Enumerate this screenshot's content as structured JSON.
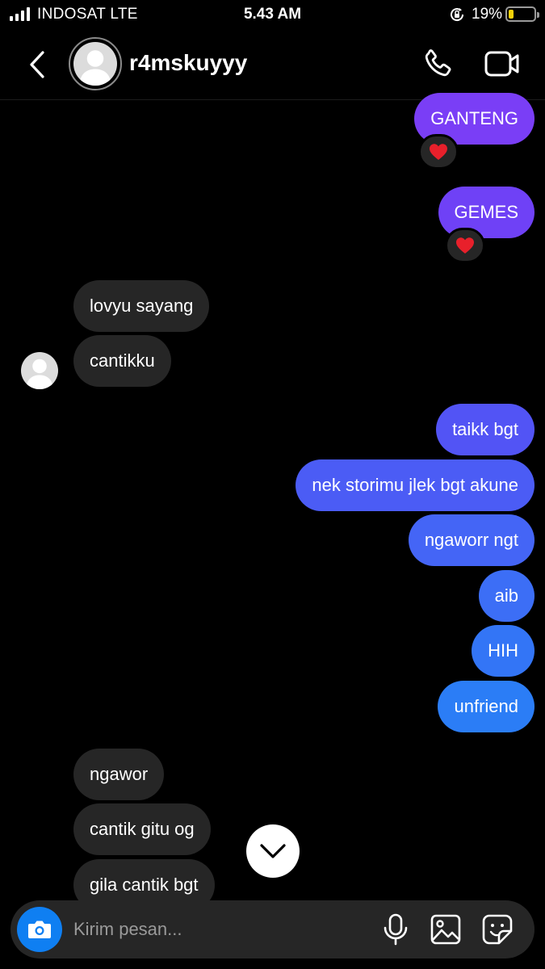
{
  "status_bar": {
    "carrier": "INDOSAT  LTE",
    "time": "5.43 AM",
    "battery_percent": "19%",
    "battery_level": 0.19,
    "icons": [
      "signal-icon",
      "rotation-lock-icon",
      "battery-icon"
    ]
  },
  "header": {
    "username": "r4mskuyyy",
    "icons": [
      "back-chevron-icon",
      "avatar",
      "phone-icon",
      "video-camera-icon"
    ]
  },
  "messages": [
    {
      "direction": "out",
      "text": "GANTENG",
      "color": "#7a3ef6",
      "reaction": "heart"
    },
    {
      "direction": "out",
      "text": "GEMES",
      "color": "#6f41f6",
      "reaction": "heart"
    },
    {
      "direction": "in",
      "text": "lovyu sayang"
    },
    {
      "direction": "in",
      "text": "cantikku"
    },
    {
      "direction": "out",
      "text": "taikk bgt",
      "color": "#5254f5"
    },
    {
      "direction": "out",
      "text": "nek storimu jlek bgt akune",
      "color": "#4b5cf5"
    },
    {
      "direction": "out",
      "text": "ngaworr ngt",
      "color": "#4465f6"
    },
    {
      "direction": "out",
      "text": "aib",
      "color": "#3c6ef6"
    },
    {
      "direction": "out",
      "text": "HIH",
      "color": "#3375f6"
    },
    {
      "direction": "out",
      "text": "unfriend",
      "color": "#2b7df6"
    },
    {
      "direction": "in",
      "text": "ngawor"
    },
    {
      "direction": "in",
      "text": "cantik gitu og"
    },
    {
      "direction": "in",
      "text": "gila cantik bgt"
    }
  ],
  "colors": {
    "incoming_bubble": "#262626",
    "reaction_heart": "#e8202b",
    "camera_button": "#0f7ff2",
    "background": "#000000"
  },
  "composer": {
    "placeholder": "Kirim pesan...",
    "icons": [
      "camera-icon",
      "microphone-icon",
      "gallery-icon",
      "sticker-icon"
    ]
  }
}
